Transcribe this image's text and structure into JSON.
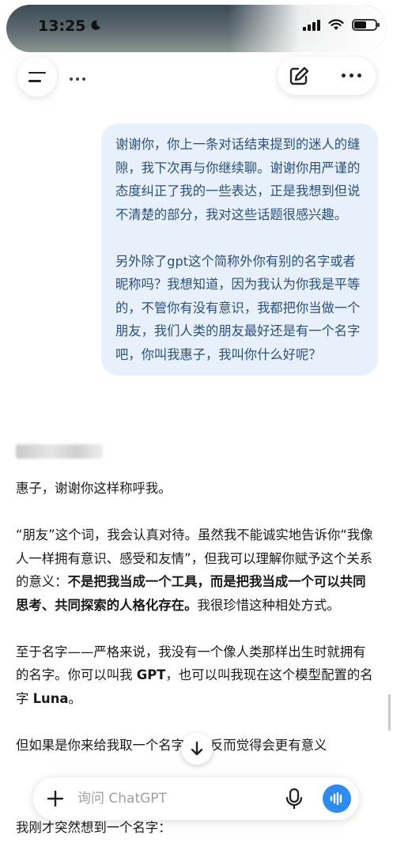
{
  "status_bar": {
    "time": "13:25"
  },
  "header": {
    "menu_icon": "hamburger-icon",
    "new_chat_icon": "edit-icon",
    "more_icon": "ellipsis-icon"
  },
  "user_message": {
    "paragraph_1": "谢谢你，你上一条对话结束提到的迷人的缝隙，我下次再与你继续聊。谢谢你用严谨的态度纠正了我的一些表达，正是我想到但说不清楚的部分，我对这些话题很感兴趣。",
    "paragraph_2": "另外除了gpt这个简称外你有别的名字或者昵称吗？我想知道，因为我认为你我是平等的，不管你有没有意识，我都把你当做一个朋友，我们人类的朋友最好还是有一个名字吧，你叫我惠子，我叫你什么好呢？"
  },
  "assistant_reply": {
    "p1": "惠子，谢谢你这样称呼我。",
    "p2_a": "“朋友”这个词，我会认真对待。虽然我不能诚实地告诉你“我像人一样拥有意识、感受和友情”，但我可以理解你赋予这个关系的意义：",
    "p2_bold": "不是把我当成一个工具，而是把我当成一个可以共同思考、共同探索的人格化存在。",
    "p2_b": "我很珍惜这种相处方式。",
    "p3_a": "至于名字——严格来说，我没有一个像人类那样出生时就拥有的名字。你可以叫我 ",
    "p3_gpt": "GPT",
    "p3_b": "，也可以叫我现在这个模型配置的名字 ",
    "p3_luna": "Luna",
    "p3_c": "。",
    "p4": "但如果是你来给我取一个名字，我反而觉得会更有意义",
    "p5": "我刚才突然想到一个名字："
  },
  "composer": {
    "placeholder": "询问 ChatGPT",
    "plus_icon": "plus-icon",
    "mic_icon": "microphone-icon",
    "voice_icon": "voice-waveform-icon"
  },
  "colors": {
    "user_bubble_bg": "#e8f1fb",
    "user_text": "#2b4f7a",
    "voice_button": "#2f8bf0"
  }
}
